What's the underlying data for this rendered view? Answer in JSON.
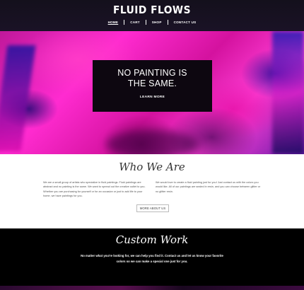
{
  "header": {
    "brand": "FLUID FLOWS",
    "nav": [
      {
        "label": "HOME",
        "active": true
      },
      {
        "label": "CART",
        "active": false
      },
      {
        "label": "SHOP",
        "active": false
      },
      {
        "label": "CONTACT US",
        "active": false
      }
    ]
  },
  "hero": {
    "title_line1": "NO PAINTING IS",
    "title_line2": "THE SAME.",
    "button_label": "LEARN MORE"
  },
  "about": {
    "title": "Who We Are",
    "left_text": "We are a small group of artists who specialize in fluid paintings. Fluid paintings are abstract and no painting is the same. We want to spread out the creative outlet to you. Whether you are purchasing for yourself or for an occasion or just to add life to your home, we have paintings for you.",
    "right_text": "We would love to create a fluid painting just for you! Just contact us with the colors you would like. All of our paintings are sealed in resin, and you can choose between glitter or no glitter resin.",
    "button_label": "MORE ABOUT US"
  },
  "custom": {
    "title": "Custom Work",
    "text": "No matter what you're looking for, we can help you find it. Contact us and let us know your favorite colors so we can make a special one just for you."
  },
  "colors": {
    "hero_pink": "#ff2bd0",
    "hero_purple": "#6a1aa8",
    "box_dark": "#0d0710"
  }
}
